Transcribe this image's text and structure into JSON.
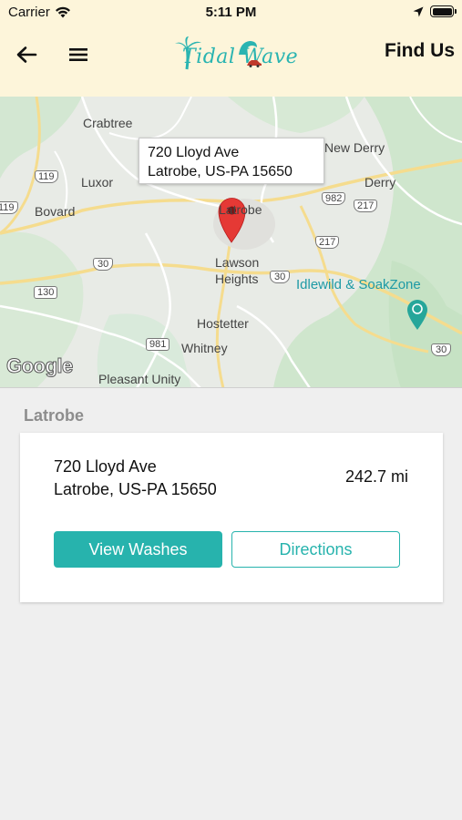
{
  "status_bar": {
    "carrier": "Carrier",
    "time": "5:11 PM"
  },
  "nav": {
    "logo_text": "Tidal Wave",
    "title": "Find Us"
  },
  "map": {
    "callout_line1": "720 Lloyd Ave",
    "callout_line2": "Latrobe, US-PA  15650",
    "labels": {
      "crabtree": "Crabtree",
      "new_derry": "New Derry",
      "luxor": "Luxor",
      "derry": "Derry",
      "bovard": "Bovard",
      "latrobe": "Latrobe",
      "lawson1": "Lawson",
      "lawson2": "Heights",
      "idlewild": "Idlewild & SoakZone",
      "hostetter": "Hostetter",
      "whitney": "Whitney",
      "pleasant_unity": "Pleasant Unity"
    },
    "shields": {
      "r119": "119",
      "r119b": "119",
      "r982": "982",
      "r217a": "217",
      "r217b": "217",
      "r30a": "30",
      "r30b": "30",
      "r30c": "30",
      "r130": "130",
      "r981": "981"
    },
    "attribution": "Google"
  },
  "location": {
    "section_title": "Latrobe",
    "address_line1": "720 Lloyd Ave",
    "address_line2": "Latrobe, US-PA  15650",
    "distance": "242.7 mi",
    "view_washes_label": "View Washes",
    "directions_label": "Directions"
  },
  "colors": {
    "header_bg": "#fdf5da",
    "accent": "#27b3ad",
    "pin": "#e53935"
  }
}
